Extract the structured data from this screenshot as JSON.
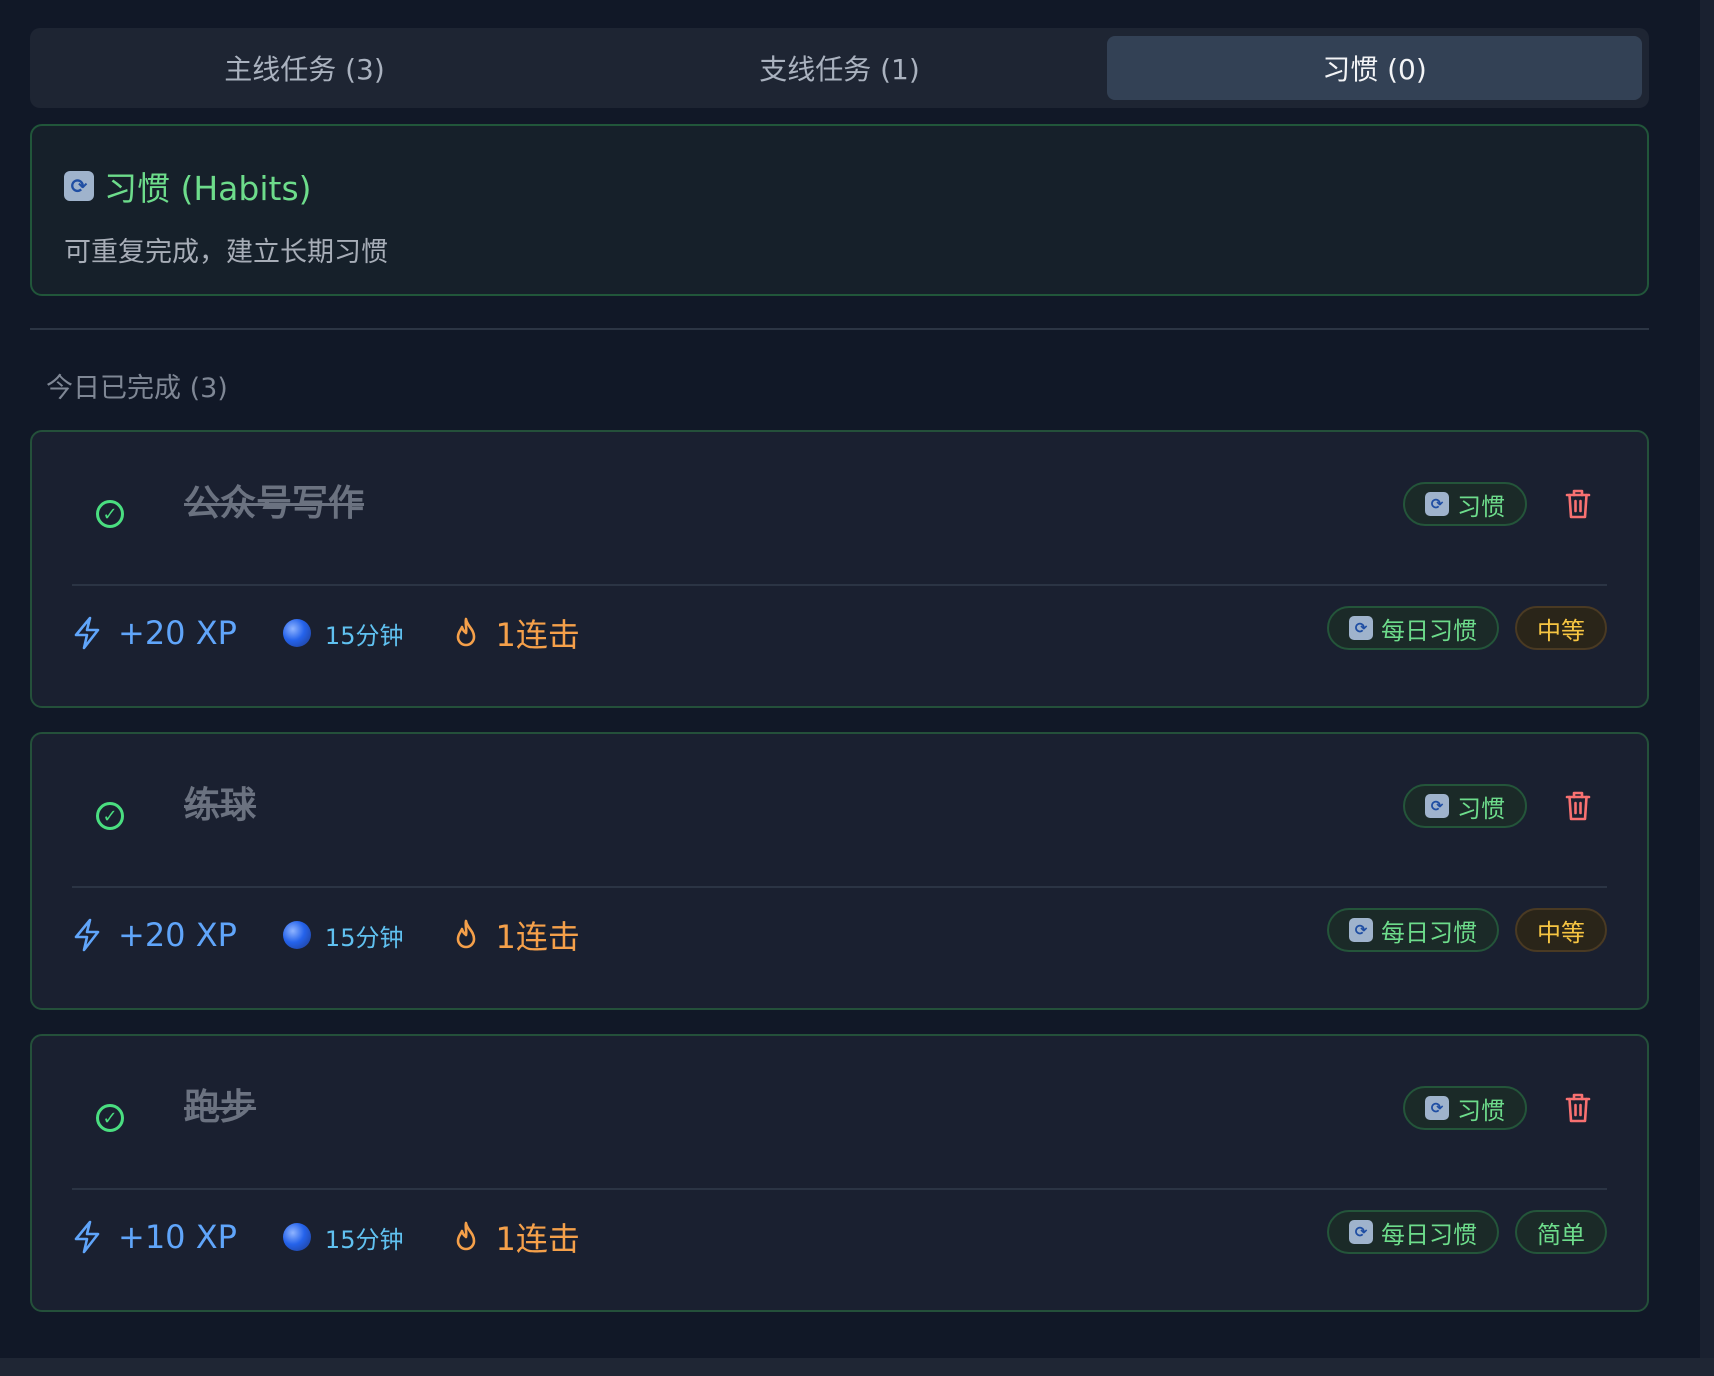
{
  "tabs": [
    {
      "label": "主线任务 (3)",
      "active": false
    },
    {
      "label": "支线任务 (1)",
      "active": false
    },
    {
      "label": "习惯 (0)",
      "active": true
    }
  ],
  "info": {
    "icon": "refresh-icon",
    "title": "习惯 (Habits)",
    "description": "可重复完成，建立长期习惯"
  },
  "section": {
    "title": "今日已完成 (3)"
  },
  "tasks": [
    {
      "title": "公众号写作",
      "type_badge": "习惯",
      "xp": "+20 XP",
      "duration": "15分钟",
      "streak": "1连击",
      "frequency": "每日习惯",
      "difficulty": "中等",
      "difficulty_level": "medium"
    },
    {
      "title": "练球",
      "type_badge": "习惯",
      "xp": "+20 XP",
      "duration": "15分钟",
      "streak": "1连击",
      "frequency": "每日习惯",
      "difficulty": "中等",
      "difficulty_level": "medium"
    },
    {
      "title": "跑步",
      "type_badge": "习惯",
      "xp": "+10 XP",
      "duration": "15分钟",
      "streak": "1连击",
      "frequency": "每日习惯",
      "difficulty": "简单",
      "difficulty_level": "easy"
    }
  ],
  "colors": {
    "background": "#111827",
    "accent_green": "#4ade80",
    "xp_blue": "#60a5fa",
    "streak_orange": "#f5a04a",
    "trash_red": "#f87171",
    "medium_yellow": "#f6c542"
  }
}
